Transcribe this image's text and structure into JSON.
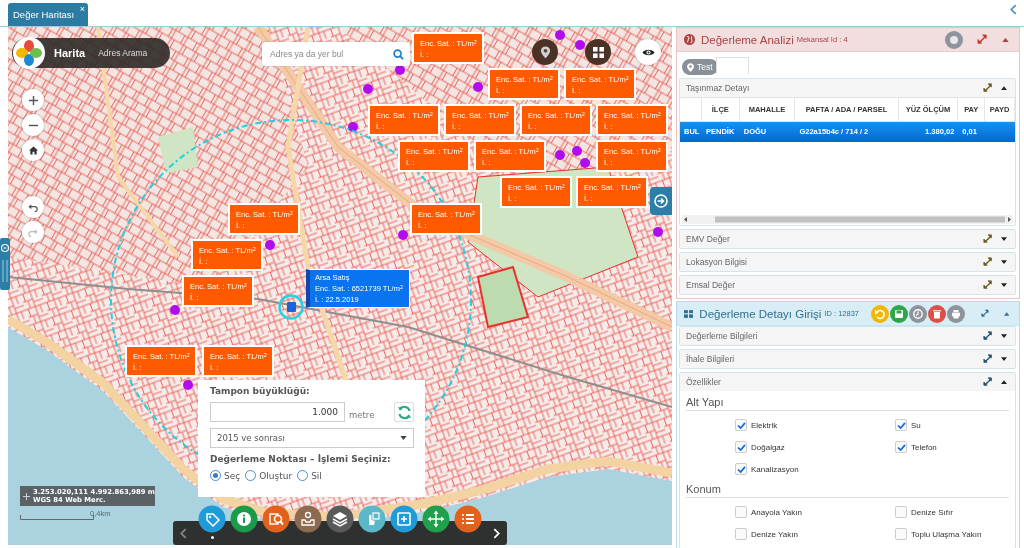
{
  "tabs": [
    {
      "label": "Değer Haritası",
      "selected": true,
      "close": "×"
    }
  ],
  "map": {
    "brand": {
      "title": "Harita",
      "link": "Adres Arama"
    },
    "search": {
      "placeholder": "Adres ya da yer bul"
    },
    "price_labels": [
      {
        "selected": false,
        "price": "Enc. Sat. : TL/m$^{2}$",
        "date": "İ. :"
      },
      {
        "selected": false,
        "price": "Enc. Sat. : TL/m$^{2}$",
        "date": "İ. :"
      },
      {
        "selected": false,
        "price": "Enc. Sat. : TL/m$^{2}$",
        "date": "İ. :"
      },
      {
        "selected": false,
        "price": "Enc. Sat. : TL/m$^{2}$",
        "date": "İ. :"
      },
      {
        "selected": false,
        "price": "Enc. Sat. : TL/m$^{2}$",
        "date": "İ. :"
      },
      {
        "selected": false,
        "price": "Enc. Sat. : TL/m$^{2}$",
        "date": "İ. :"
      },
      {
        "selected": false,
        "price": "Enc. Sat. : TL/m$^{2}$",
        "date": "İ. :"
      },
      {
        "selected": false,
        "price": "Enc. Sat. : TL/m$^{2}$",
        "date": "İ. :"
      },
      {
        "selected": false,
        "price": "Enc. Sat. : TL/m$^{2}$",
        "date": "İ. :"
      },
      {
        "selected": false,
        "price": "Enc. Sat. : TL/m$^{2}$",
        "date": "İ. :"
      },
      {
        "selected": false,
        "price": "Enc. Sat. : TL/m$^{2}$",
        "date": "İ. :"
      },
      {
        "selected": false,
        "price": "Enc. Sat. : TL/m$^{2}$",
        "date": "İ. :"
      },
      {
        "selected": false,
        "price": "Enc. Sat. : TL/m$^{2}$",
        "date": "İ. :"
      },
      {
        "selected": false,
        "price": "Enc. Sat. : TL/m$^{2}$",
        "date": "İ. :"
      },
      {
        "selected": false,
        "price": "Enc. Sat. : TL/m$^{2}$",
        "date": "İ. :"
      },
      {
        "selected": false,
        "price": "Enc. Sat. : TL/m$^{2}$",
        "date": "İ. :"
      },
      {
        "selected": true,
        "title": "Arsa Satış",
        "price": "Enc. Sat. : 6521739 TL/m$^{2}$",
        "date": "İ. : 22.5.2019"
      },
      {
        "selected": false,
        "price": "Enc. Sat. : TL/m$^{2}$",
        "date": "İ. :"
      },
      {
        "selected": false,
        "price": "Enc. Sat. : TL/m$^{2}$",
        "date": "İ. :"
      }
    ],
    "buffer": {
      "title": "Tampon büyüklüğü:",
      "size": "1.000",
      "unit": "metre",
      "period": "2015 ve sonrası",
      "prompt": "Değerleme Noktası – İşlemi Seçiniz:",
      "modes": [
        {
          "label": "Seç",
          "selected": true
        },
        {
          "label": "Oluştur",
          "selected": false
        },
        {
          "label": "Sil",
          "selected": false
        }
      ]
    },
    "coordinates": {
      "position": "3.253.020,111 4.992.863,989 m",
      "projection": "WGS 84 Web Merc."
    },
    "scale": "0,4km",
    "toolbar": [
      {
        "kind": "tag",
        "selected": true
      },
      {
        "kind": "info",
        "selected": false
      },
      {
        "kind": "search",
        "selected": false
      },
      {
        "kind": "tray",
        "selected": false
      },
      {
        "kind": "layers",
        "selected": false
      },
      {
        "kind": "pointer",
        "selected": false
      },
      {
        "kind": "add",
        "selected": false
      },
      {
        "kind": "move",
        "selected": false
      },
      {
        "kind": "list",
        "selected": false
      }
    ]
  },
  "analysis": {
    "title": "Değerleme Analizi",
    "subtitle": "Mekansal Id : 4",
    "expanded": true,
    "chip": "Test",
    "sections": [
      {
        "title": "Taşınmaz Detayı",
        "expanded": true,
        "table": {
          "columns": [
            "İLÇE",
            "MAHALLE",
            "PAFTA / ADA / PARSEL",
            "YÜZ ÖLÇÜM",
            "PAY",
            "PAYD"
          ],
          "rows": [
            {
              "selected": true,
              "column_1": "BUL",
              "cells": [
                "PENDİK",
                "DOĞU",
                "G22a15b4c / 714 / 2",
                "1.380,02",
                "0,01"
              ]
            }
          ]
        }
      },
      {
        "title": "EMV Değer",
        "expanded": false
      },
      {
        "title": "Lokasyon Bilgisi",
        "expanded": false
      },
      {
        "title": "Emsal Değer",
        "expanded": false
      }
    ]
  },
  "entry": {
    "title": "Değerleme Detayı Girişi",
    "subtitle": "ID : 12837",
    "expanded": true,
    "actions": [
      {
        "kind": "undo"
      },
      {
        "kind": "save"
      },
      {
        "kind": "history"
      },
      {
        "kind": "delete"
      },
      {
        "kind": "print"
      }
    ],
    "sections": [
      {
        "title": "Değerleme Bilgileri",
        "expanded": false
      },
      {
        "title": "İhale Bilgileri",
        "expanded": false
      },
      {
        "title": "Özellikler",
        "expanded": true,
        "groups": [
          {
            "title": "Alt Yapı",
            "options": [
              {
                "label": "Elektrik",
                "checked": true
              },
              {
                "label": "Su",
                "checked": true
              },
              {
                "label": "Doğalgaz",
                "checked": true
              },
              {
                "label": "Telefon",
                "checked": true
              },
              {
                "label": "Kanalizasyon",
                "checked": true
              }
            ]
          },
          {
            "title": "Konum",
            "options": [
              {
                "label": "Anayola Yakın",
                "checked": false
              },
              {
                "label": "Denize Sıfır",
                "checked": false
              },
              {
                "label": "Denize Yakın",
                "checked": false
              },
              {
                "label": "Toplu Ulaşma Yakın",
                "checked": false
              }
            ]
          }
        ]
      }
    ]
  }
}
